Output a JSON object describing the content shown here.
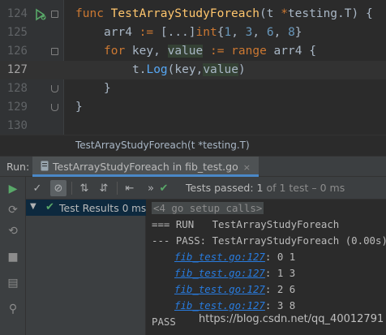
{
  "editor": {
    "lines": [
      {
        "num": "124"
      },
      {
        "num": "125"
      },
      {
        "num": "126"
      },
      {
        "num": "127"
      },
      {
        "num": "128"
      },
      {
        "num": "129"
      },
      {
        "num": "130"
      }
    ],
    "code": {
      "l124": {
        "kw": "func",
        "name": "TestArrayStudyForeach",
        "open": "(t ",
        "star": "*",
        "pkg": "testing",
        "dot": ".",
        "type": "T",
        "close": ") {"
      },
      "l125": {
        "var": "arr4 ",
        "op": ":= ",
        "lit1": "[...]",
        "type": "int",
        "brace": "{",
        "n1": "1",
        "c1": ", ",
        "n2": "3",
        "c2": ", ",
        "n3": "6",
        "c3": ", ",
        "n4": "8",
        "end": "}"
      },
      "l126": {
        "kw": "for",
        "key": " key, ",
        "value": "value",
        "op": " := ",
        "range": "range",
        "rest": " arr4 {"
      },
      "l127": {
        "recv": "t.",
        "call": "Log",
        "open": "(key,",
        "value": "value",
        "close": ")"
      },
      "l128": {
        "text": "}"
      },
      "l129": {
        "text": "}"
      },
      "l130": {
        "text": ""
      }
    },
    "breadcrumb": "TestArrayStudyForeach(t *testing.T)"
  },
  "run_window": {
    "label": "Run:",
    "tab_label": "TestArrayStudyForeach in fib_test.go",
    "tab_close": "×",
    "status_prefix": "Tests passed: ",
    "status_count": "1",
    "status_suffix": " of 1 test – 0 ms",
    "tree": {
      "label": "Test Results",
      "time": "0 ms"
    },
    "console": {
      "setup": "<4 go setup calls>",
      "run_line": "=== RUN   TestArrayStudyForeach",
      "pass_line": "--- PASS: TestArrayStudyForeach (0.00s)",
      "outputs": [
        {
          "link": "fib_test.go:127",
          "value": ": 0 1"
        },
        {
          "link": "fib_test.go:127",
          "value": ": 1 3"
        },
        {
          "link": "fib_test.go:127",
          "value": ": 2 6"
        },
        {
          "link": "fib_test.go:127",
          "value": ": 3 8"
        }
      ],
      "final": "PASS"
    }
  },
  "watermark": "https://blog.csdn.net/qq_40012791",
  "icons": {
    "gutter_run": "run-test-gutter-icon",
    "tab": "go-test-file-icon"
  },
  "colors": {
    "accent": "#4a88c7",
    "pass_green": "#59a869",
    "link_blue": "#287bde"
  }
}
